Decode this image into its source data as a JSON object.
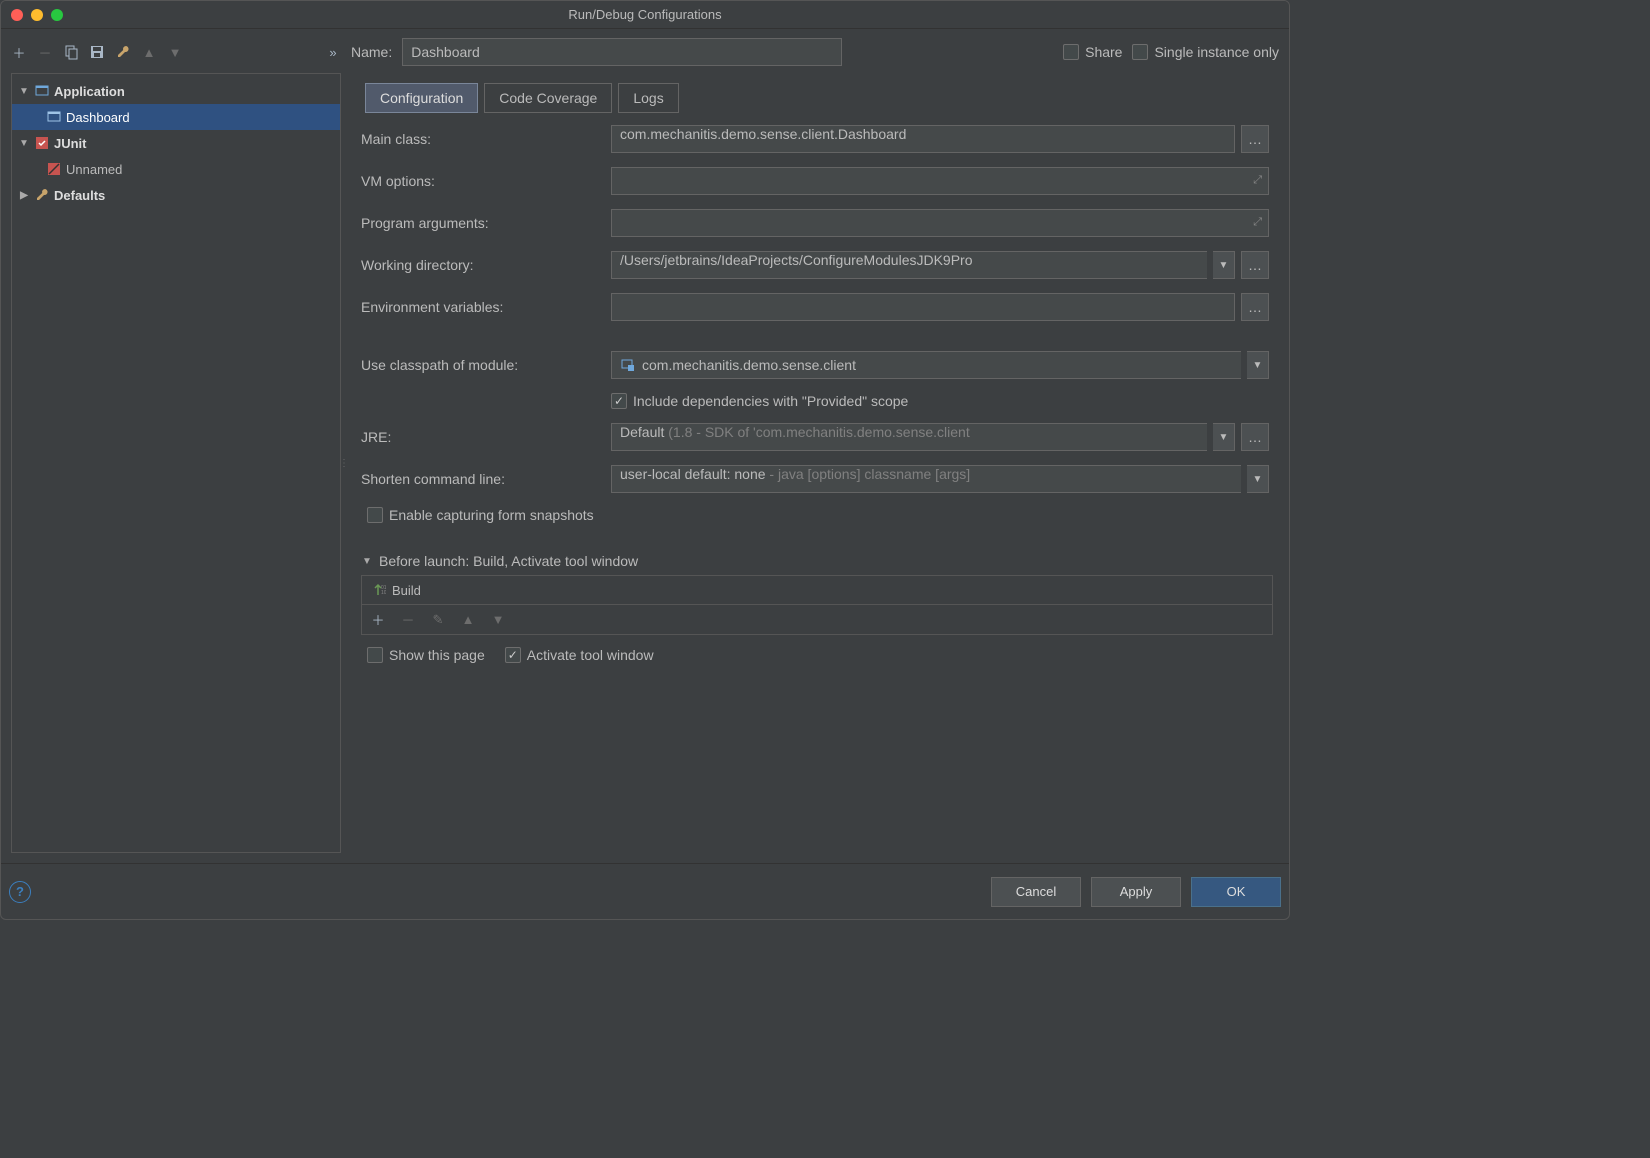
{
  "window": {
    "title": "Run/Debug Configurations"
  },
  "tree": {
    "app_label": "Application",
    "app_child": "Dashboard",
    "junit_label": "JUnit",
    "junit_child": "Unnamed",
    "defaults_label": "Defaults"
  },
  "namerow": {
    "label": "Name:",
    "value": "Dashboard",
    "share": "Share",
    "single": "Single instance only"
  },
  "tabs": {
    "t1": "Configuration",
    "t2": "Code Coverage",
    "t3": "Logs"
  },
  "form": {
    "main_class_label": "Main class:",
    "main_class_value": "com.mechanitis.demo.sense.client.Dashboard",
    "vm_label": "VM options:",
    "vm_value": "",
    "args_label": "Program arguments:",
    "args_value": "",
    "wd_label": "Working directory:",
    "wd_value": "/Users/jetbrains/IdeaProjects/ConfigureModulesJDK9Pro",
    "env_label": "Environment variables:",
    "env_value": "",
    "cp_label": "Use classpath of module:",
    "cp_value": "com.mechanitis.demo.sense.client",
    "provided": "Include dependencies with \"Provided\" scope",
    "jre_label": "JRE:",
    "jre_value_a": "Default ",
    "jre_value_b": "(1.8 - SDK of 'com.mechanitis.demo.sense.client",
    "shorten_label": "Shorten command line:",
    "shorten_a": "user-local default: none",
    "shorten_b": " - java [options] classname [args]",
    "snapshots": "Enable capturing form snapshots"
  },
  "before": {
    "header": "Before launch: Build, Activate tool window",
    "item": "Build",
    "showpage": "Show this page",
    "activate": "Activate tool window"
  },
  "buttons": {
    "cancel": "Cancel",
    "apply": "Apply",
    "ok": "OK"
  }
}
